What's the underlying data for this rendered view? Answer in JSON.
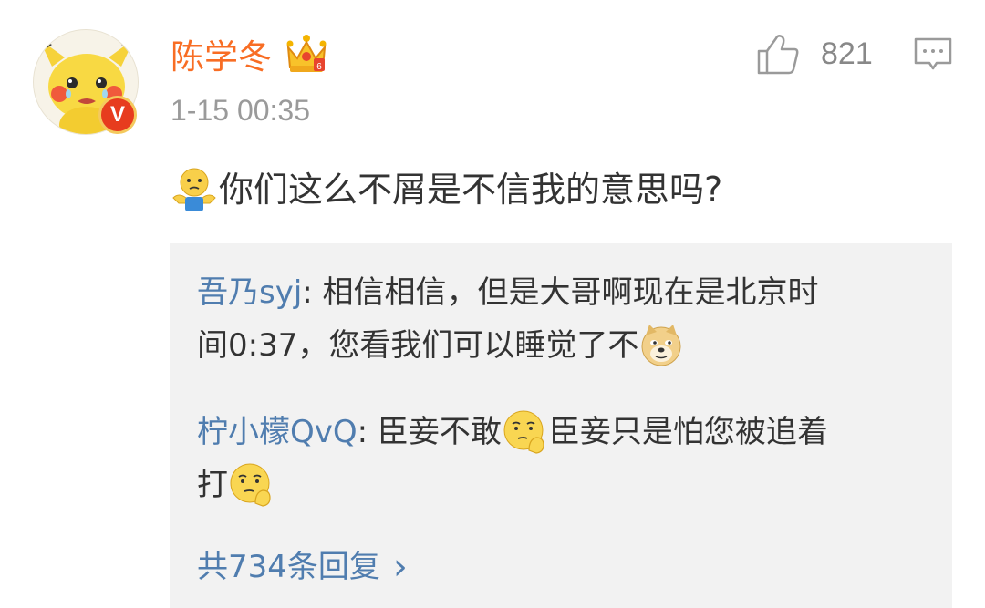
{
  "comment": {
    "username": "陈学冬",
    "avatar_badge": "V",
    "timestamp": "1-15 00:35",
    "like_count": "821",
    "text": "你们这么不屑是不信我的意思吗?"
  },
  "replies": [
    {
      "name": "吾乃syj",
      "sep": ": ",
      "text_line1": "相信相信，但是大哥啊现在是北京时",
      "text_line2": "间0:37，您看我们可以睡觉了不"
    },
    {
      "name": "柠小檬QvQ",
      "sep": ": ",
      "text_a": "臣妾不敢",
      "text_b": "臣妾只是怕您被追着",
      "text_c": "打"
    }
  ],
  "more_replies": {
    "label": "共734条回复",
    "chevron": "›"
  },
  "icons": {
    "like": "thumbs-up-icon",
    "comment": "comment-icon",
    "crown": "crown-icon",
    "doge": "doge-emoji-icon",
    "shrug": "shrug-emoji-icon",
    "thinking": "thinking-emoji-icon"
  },
  "colors": {
    "username": "#f86d24",
    "reply_name": "#507daf",
    "reply_bg": "#f2f2f2",
    "badge": "#e73c1e"
  }
}
